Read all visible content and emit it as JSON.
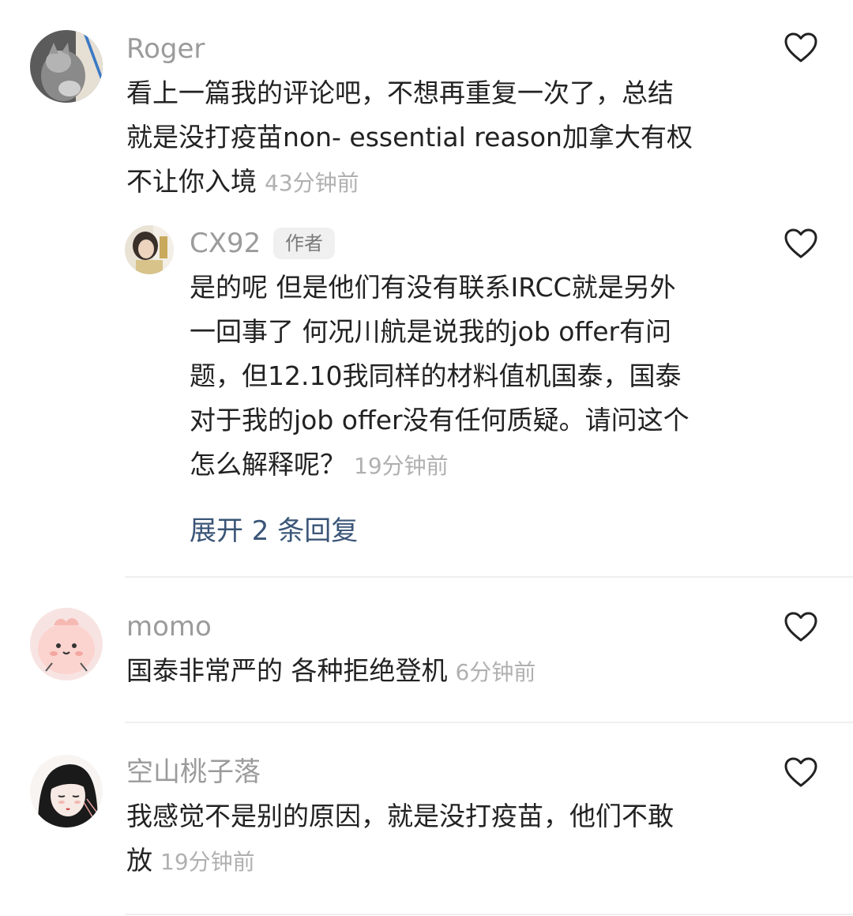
{
  "comments": [
    {
      "username": "Roger",
      "lines": [
        "看上一篇我的评论吧，不想再重复一次了，总结",
        "就是没打疫苗non- essential reason加拿大有权",
        "不让你入境"
      ],
      "time": "43分钟前",
      "avatar_icon": "cat-photo-avatar-icon"
    },
    {
      "username": "CX92",
      "badge": "作者",
      "lines": [
        "是的呢 但是他们有没有联系IRCC就是另外",
        "一回事了 何况川航是说我的job offer有问",
        "题，但12.10我同样的材料值机国泰，国泰",
        "对于我的job offer没有任何质疑。请问这个",
        "怎么解释呢？"
      ],
      "time": "19分钟前",
      "expand_label": "展开 2 条回复",
      "avatar_icon": "girl-photo-avatar-icon"
    },
    {
      "username": "momo",
      "lines": [
        "国泰非常严的 各种拒绝登机"
      ],
      "time": "6分钟前",
      "avatar_icon": "pink-blob-avatar-icon"
    },
    {
      "username": "空山桃子落",
      "lines": [
        "我感觉不是别的原因，就是没打疫苗，他们不敢",
        "放"
      ],
      "time": "19分钟前",
      "avatar_icon": "illustrated-girl-avatar-icon"
    }
  ],
  "icons": {
    "like": "heart-outline-icon"
  },
  "colors": {
    "username": "#9b9b9b",
    "text": "#222222",
    "time": "#b0b0b0",
    "link": "#3a5577",
    "divider": "#efefef"
  }
}
